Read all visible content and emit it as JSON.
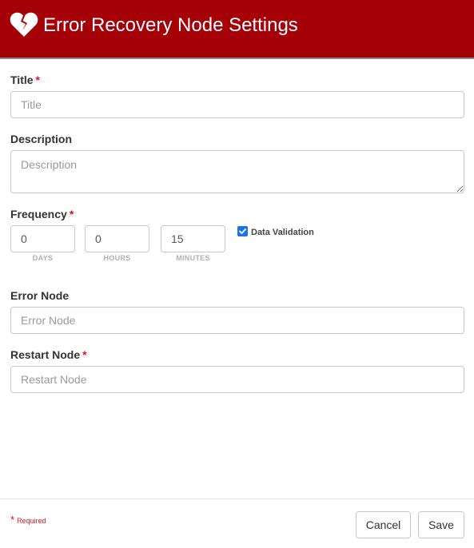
{
  "header": {
    "title": "Error Recovery Node Settings",
    "icon": "broken-heart-icon",
    "background": "#a50008"
  },
  "fields": {
    "title": {
      "label": "Title",
      "required_mark": "*",
      "placeholder": "Title",
      "value": ""
    },
    "description": {
      "label": "Description",
      "placeholder": "Description",
      "value": ""
    },
    "frequency": {
      "label": "Frequency",
      "required_mark": "*",
      "days": {
        "value": "0",
        "unit": "DAYS"
      },
      "hours": {
        "value": "0",
        "unit": "HOURS"
      },
      "minutes": {
        "value": "15",
        "unit": "MINUTES"
      },
      "data_validation": {
        "label": "Data Validation",
        "checked": true
      }
    },
    "error_node": {
      "label": "Error Node",
      "placeholder": "Error Node",
      "value": ""
    },
    "restart_node": {
      "label": "Restart Node",
      "required_mark": "*",
      "placeholder": "Restart Node",
      "value": ""
    }
  },
  "footer": {
    "required_star": "*",
    "required_label": "Required",
    "cancel_label": "Cancel",
    "save_label": "Save"
  },
  "colors": {
    "required": "#d9161f",
    "accent": "#a50008"
  }
}
